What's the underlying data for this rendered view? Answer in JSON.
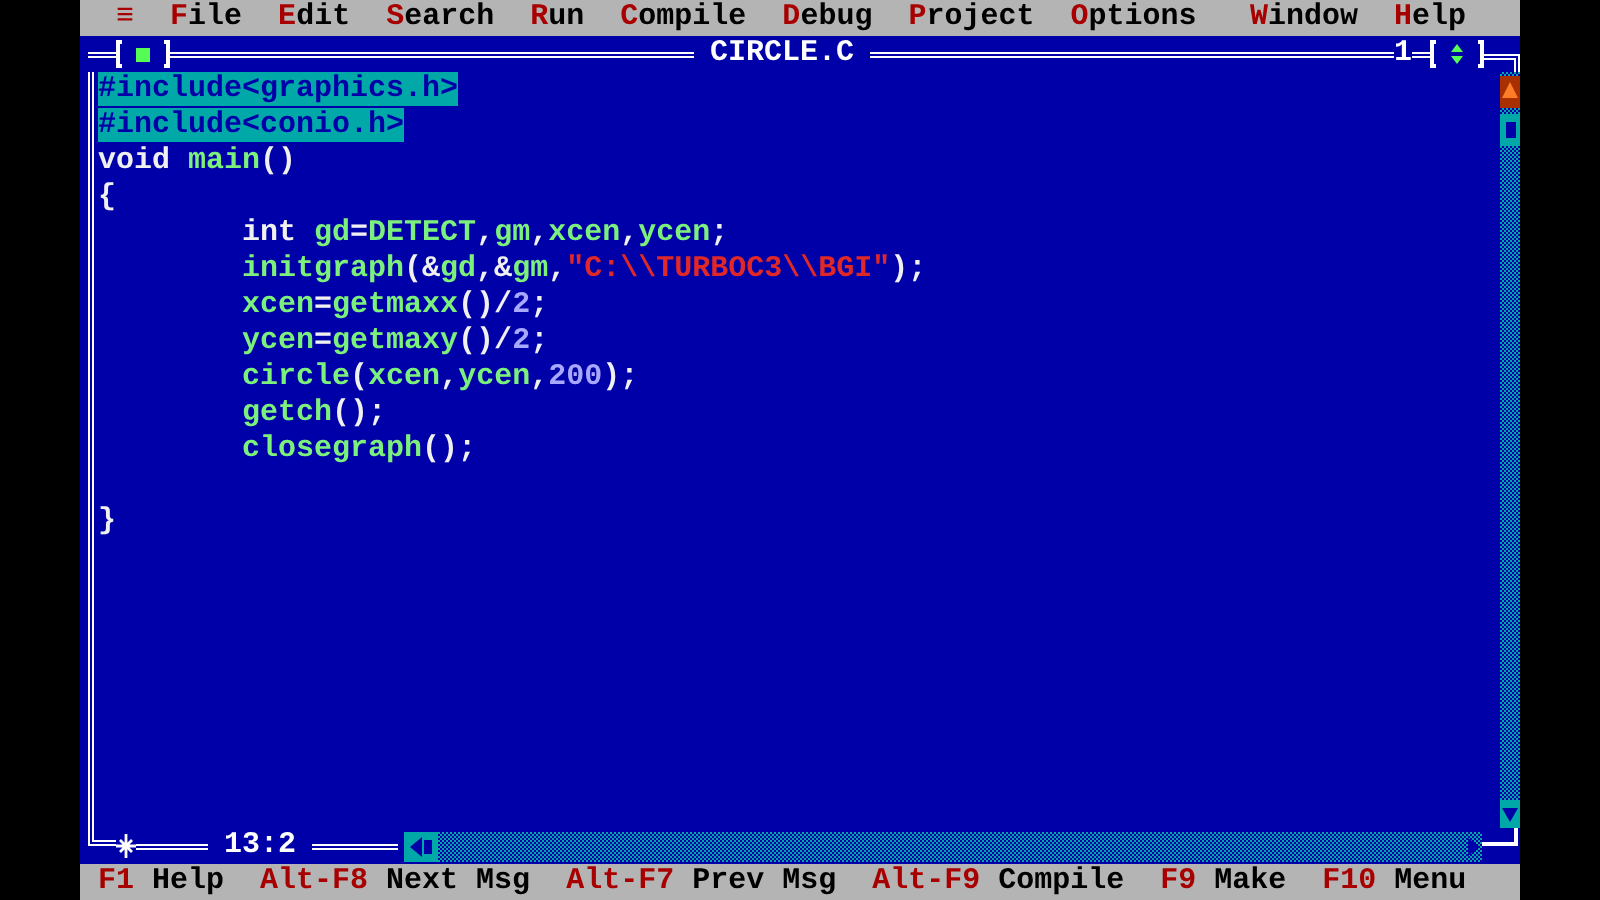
{
  "menu_bar": {
    "system_menu": "≡",
    "items": [
      {
        "hotkey": "F",
        "rest": "ile"
      },
      {
        "hotkey": "E",
        "rest": "dit"
      },
      {
        "hotkey": "S",
        "rest": "earch"
      },
      {
        "hotkey": "R",
        "rest": "un"
      },
      {
        "hotkey": "C",
        "rest": "ompile"
      },
      {
        "hotkey": "D",
        "rest": "ebug"
      },
      {
        "hotkey": "P",
        "rest": "roject"
      },
      {
        "hotkey": "O",
        "rest": "ptions"
      },
      {
        "hotkey": "W",
        "rest": "indow"
      },
      {
        "hotkey": "H",
        "rest": "elp"
      }
    ]
  },
  "editor": {
    "title": "CIRCLE.C",
    "window_number": "1",
    "cursor_position": "13:2",
    "lines": [
      {
        "kind": "code",
        "selected": true,
        "tokens": [
          {
            "kind": "preprocessor",
            "text": "#include<graphics.h>"
          }
        ]
      },
      {
        "kind": "code",
        "selected": true,
        "tokens": [
          {
            "kind": "preprocessor",
            "text": "#include<conio.h>"
          }
        ]
      },
      {
        "kind": "code",
        "selected": false,
        "tokens": [
          {
            "kind": "keyword",
            "text": "void"
          },
          {
            "kind": "identifier",
            "text": " main"
          },
          {
            "kind": "symbol",
            "text": "()"
          }
        ]
      },
      {
        "kind": "code",
        "selected": false,
        "tokens": [
          {
            "kind": "symbol",
            "text": "{"
          }
        ]
      },
      {
        "kind": "code",
        "selected": false,
        "indented": true,
        "tokens": [
          {
            "kind": "keyword",
            "text": "int"
          },
          {
            "kind": "identifier",
            "text": " gd"
          },
          {
            "kind": "symbol",
            "text": "="
          },
          {
            "kind": "identifier",
            "text": "DETECT"
          },
          {
            "kind": "symbol",
            "text": ","
          },
          {
            "kind": "identifier",
            "text": "gm"
          },
          {
            "kind": "symbol",
            "text": ","
          },
          {
            "kind": "identifier",
            "text": "xcen"
          },
          {
            "kind": "symbol",
            "text": ","
          },
          {
            "kind": "identifier",
            "text": "ycen"
          },
          {
            "kind": "symbol",
            "text": ";"
          }
        ]
      },
      {
        "kind": "code",
        "selected": false,
        "indented": true,
        "tokens": [
          {
            "kind": "identifier",
            "text": "initgraph"
          },
          {
            "kind": "symbol",
            "text": "(&"
          },
          {
            "kind": "identifier",
            "text": "gd"
          },
          {
            "kind": "symbol",
            "text": ",&"
          },
          {
            "kind": "identifier",
            "text": "gm"
          },
          {
            "kind": "symbol",
            "text": ","
          },
          {
            "kind": "string",
            "text": "\"C:\\\\TURBOC3\\\\BGI\""
          },
          {
            "kind": "symbol",
            "text": ");"
          }
        ]
      },
      {
        "kind": "code",
        "selected": false,
        "indented": true,
        "tokens": [
          {
            "kind": "identifier",
            "text": "xcen"
          },
          {
            "kind": "symbol",
            "text": "="
          },
          {
            "kind": "identifier",
            "text": "getmaxx"
          },
          {
            "kind": "symbol",
            "text": "()/"
          },
          {
            "kind": "number",
            "text": "2"
          },
          {
            "kind": "symbol",
            "text": ";"
          }
        ]
      },
      {
        "kind": "code",
        "selected": false,
        "indented": true,
        "tokens": [
          {
            "kind": "identifier",
            "text": "ycen"
          },
          {
            "kind": "symbol",
            "text": "="
          },
          {
            "kind": "identifier",
            "text": "getmaxy"
          },
          {
            "kind": "symbol",
            "text": "()/"
          },
          {
            "kind": "number",
            "text": "2"
          },
          {
            "kind": "symbol",
            "text": ";"
          }
        ]
      },
      {
        "kind": "code",
        "selected": false,
        "indented": true,
        "tokens": [
          {
            "kind": "identifier",
            "text": "circle"
          },
          {
            "kind": "symbol",
            "text": "("
          },
          {
            "kind": "identifier",
            "text": "xcen"
          },
          {
            "kind": "symbol",
            "text": ","
          },
          {
            "kind": "identifier",
            "text": "ycen"
          },
          {
            "kind": "symbol",
            "text": ","
          },
          {
            "kind": "number",
            "text": "200"
          },
          {
            "kind": "symbol",
            "text": ");"
          }
        ]
      },
      {
        "kind": "code",
        "selected": false,
        "indented": true,
        "tokens": [
          {
            "kind": "identifier",
            "text": "getch"
          },
          {
            "kind": "symbol",
            "text": "();"
          }
        ]
      },
      {
        "kind": "code",
        "selected": false,
        "indented": true,
        "tokens": [
          {
            "kind": "identifier",
            "text": "closegraph"
          },
          {
            "kind": "symbol",
            "text": "();"
          }
        ]
      },
      {
        "kind": "blank"
      },
      {
        "kind": "code",
        "selected": false,
        "tokens": [
          {
            "kind": "symbol",
            "text": "}"
          }
        ]
      }
    ]
  },
  "status_bar": [
    {
      "key": "F1",
      "label": "Help"
    },
    {
      "key": "Alt-F8",
      "label": "Next Msg"
    },
    {
      "key": "Alt-F7",
      "label": "Prev Msg"
    },
    {
      "key": "Alt-F9",
      "label": "Compile"
    },
    {
      "key": "F9",
      "label": "Make"
    },
    {
      "key": "F10",
      "label": "Menu"
    }
  ]
}
